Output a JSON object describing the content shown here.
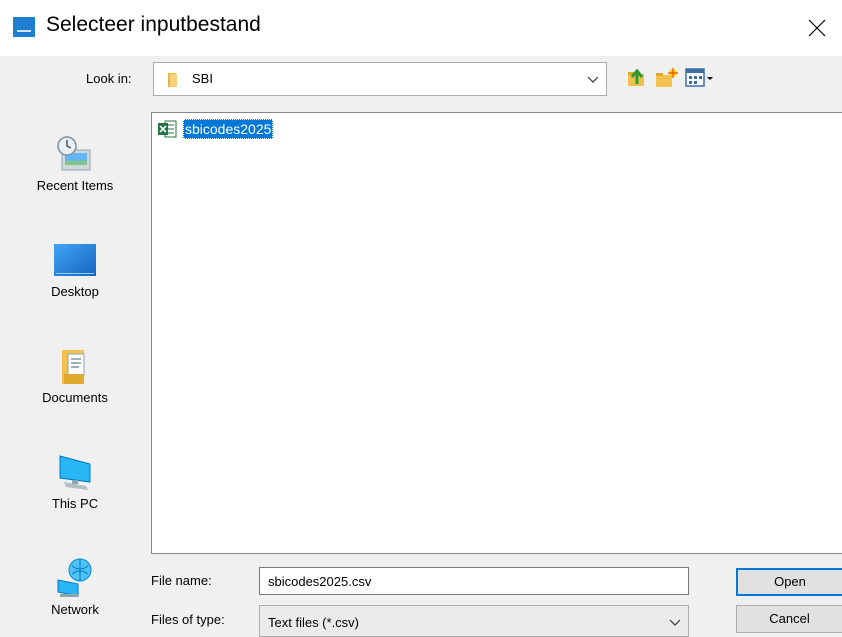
{
  "window": {
    "title": "Selecteer inputbestand",
    "accent": "#0078d7"
  },
  "lookin": {
    "label": "Look in:",
    "value": "SBI"
  },
  "places": [
    {
      "label": "Recent Items",
      "icon": "recent-items-icon"
    },
    {
      "label": "Desktop",
      "icon": "desktop-icon"
    },
    {
      "label": "Documents",
      "icon": "documents-icon"
    },
    {
      "label": "This PC",
      "icon": "this-pc-icon"
    },
    {
      "label": "Network",
      "icon": "network-icon"
    }
  ],
  "files": [
    {
      "name": "sbicodes2025",
      "icon": "excel-csv-icon",
      "selected": true
    }
  ],
  "filename": {
    "label": "File name:",
    "value": "sbicodes2025.csv"
  },
  "filetype": {
    "label": "Files of type:",
    "value": "Text files (*.csv)"
  },
  "buttons": {
    "open": "Open",
    "cancel": "Cancel"
  }
}
